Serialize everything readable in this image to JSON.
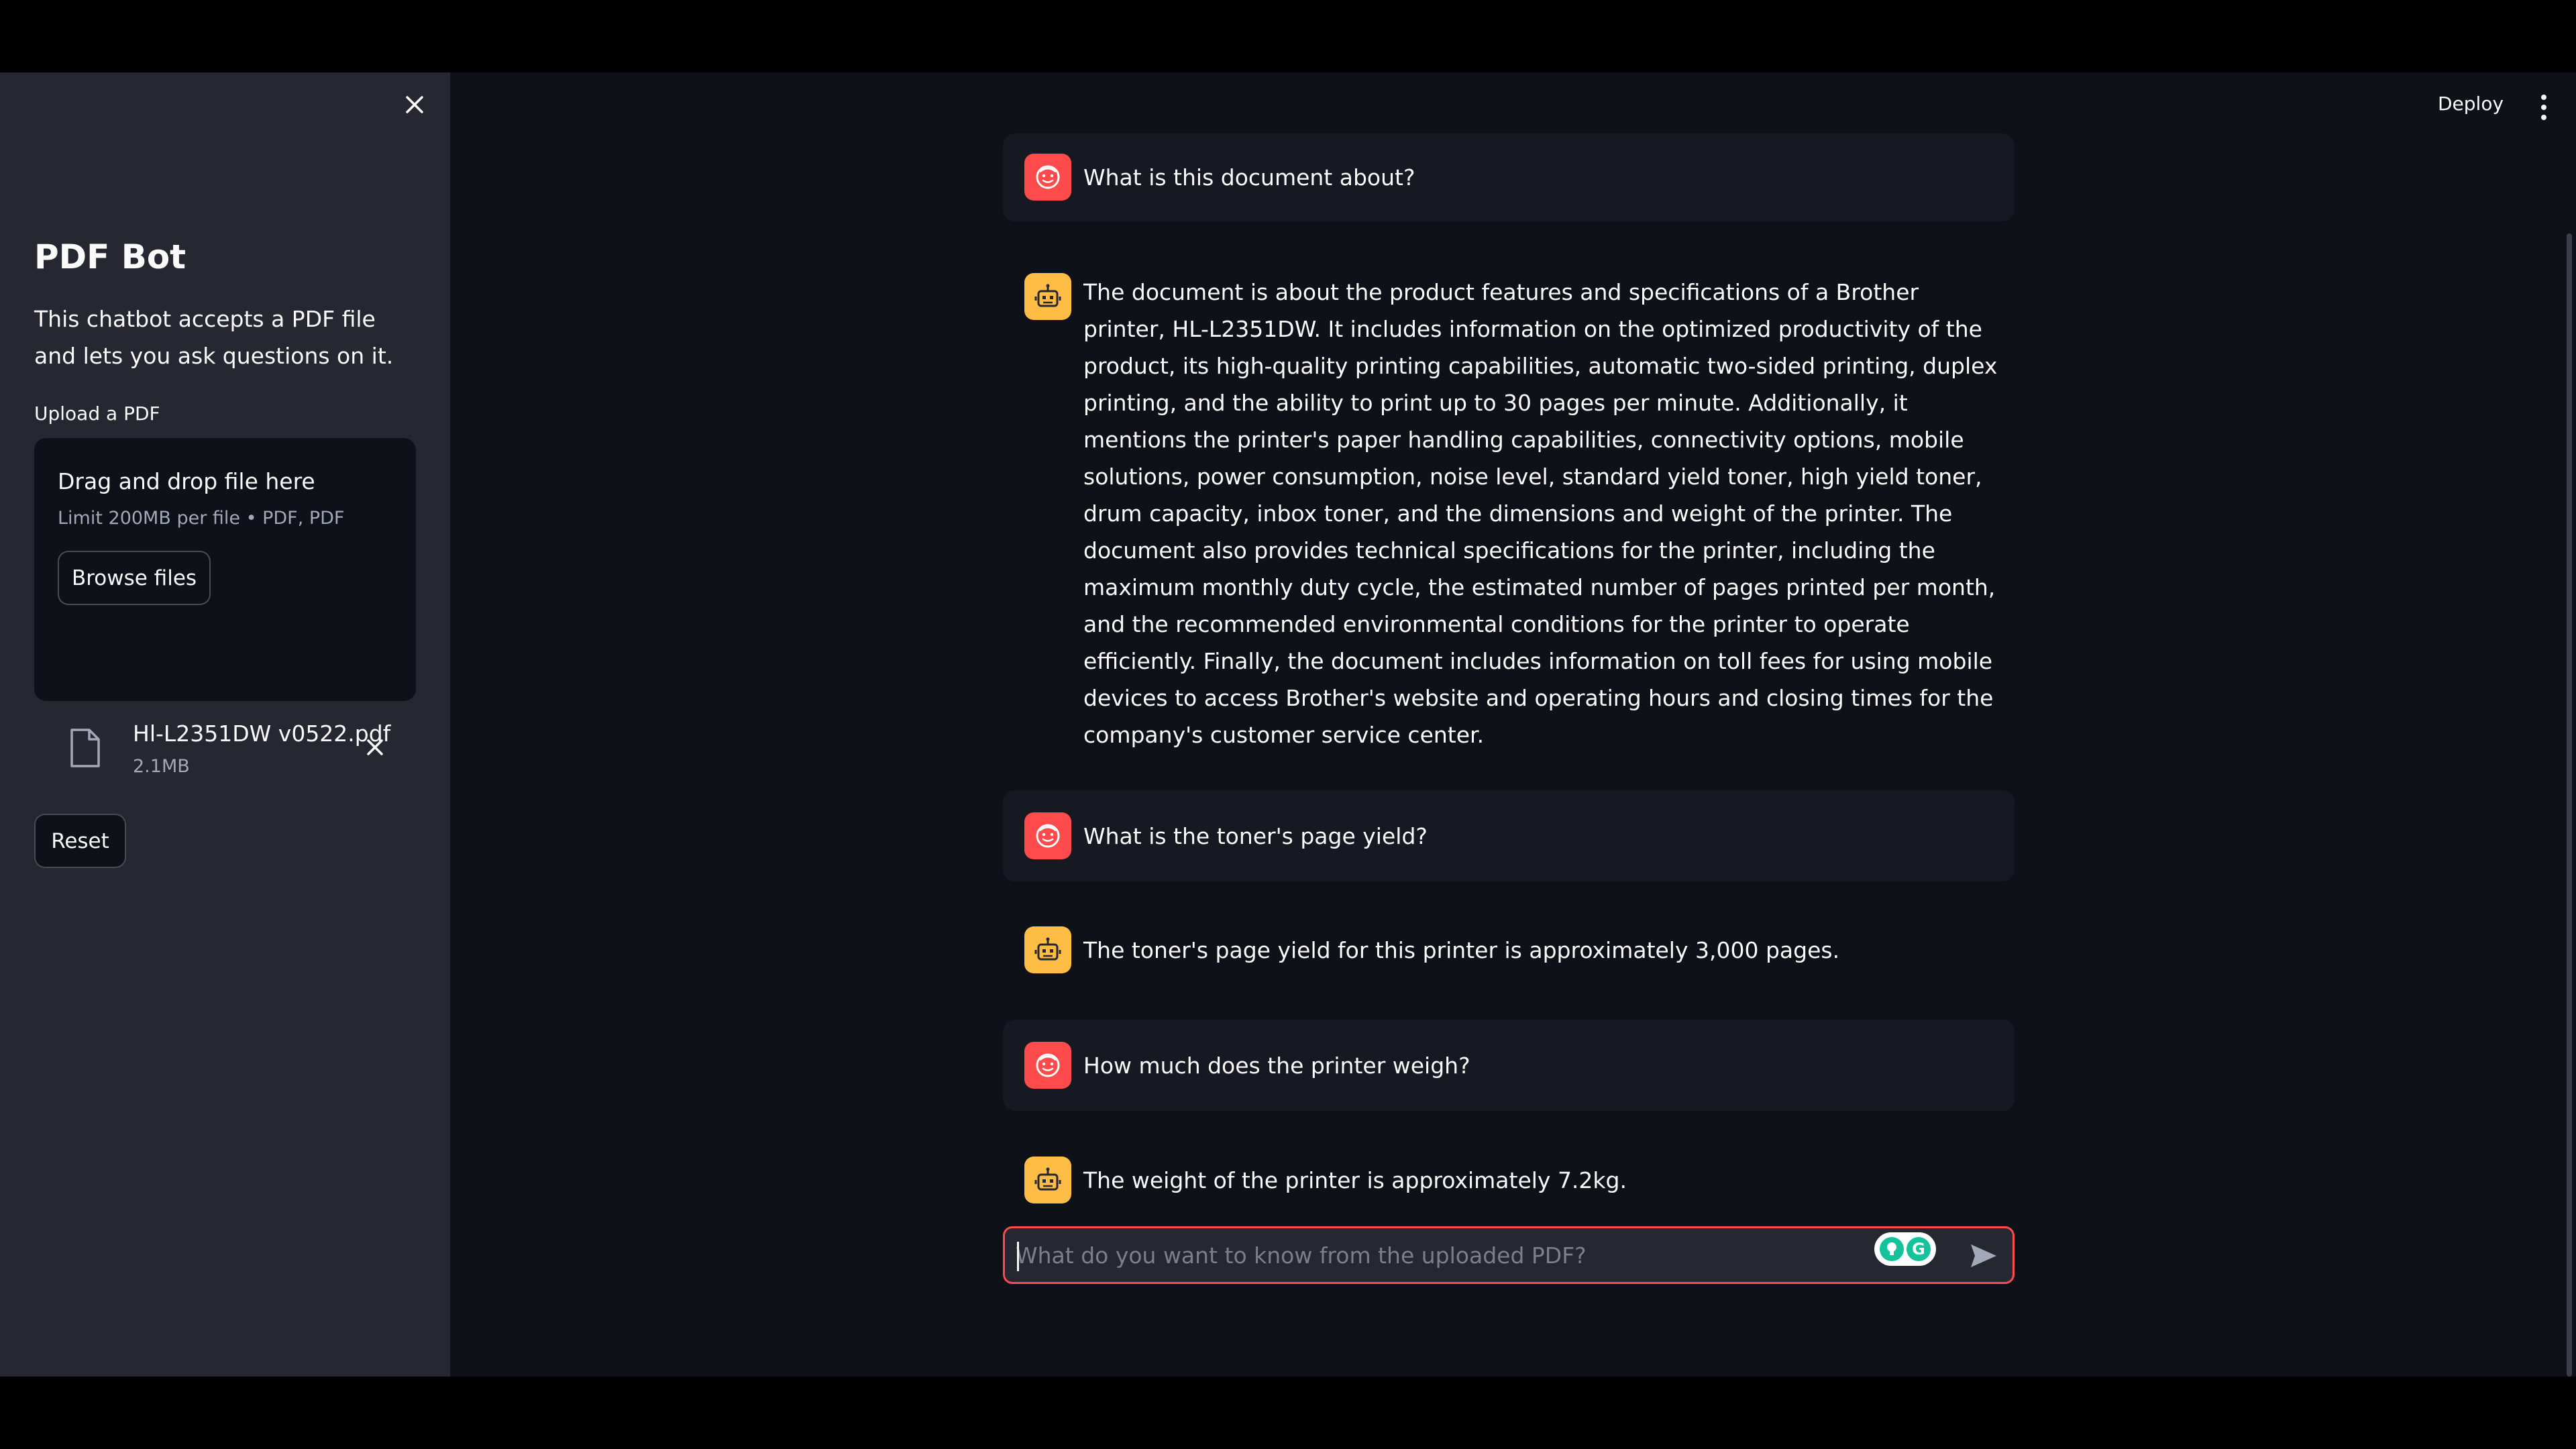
{
  "sidebar": {
    "title": "PDF Bot",
    "description": "This chatbot accepts a PDF file and lets you ask questions on it.",
    "upload_label": "Upload a PDF",
    "dropzone": {
      "title": "Drag and drop file here",
      "limit": "Limit 200MB per file • PDF, PDF",
      "browse_label": "Browse files"
    },
    "uploaded_file": {
      "name": "Hl-L2351DW v0522.pdf",
      "size": "2.1MB"
    },
    "reset_label": "Reset"
  },
  "header": {
    "deploy_label": "Deploy"
  },
  "chat": {
    "messages": [
      {
        "role": "user",
        "text": "What is this document about?"
      },
      {
        "role": "assistant",
        "text": "The document is about the product features and specifications of a Brother printer, HL-L2351DW. It includes information on the optimized productivity of the product, its high-quality printing capabilities, automatic two-sided printing, duplex printing, and the ability to print up to 30 pages per minute. Additionally, it mentions the printer's paper handling capabilities, connectivity options, mobile solutions, power consumption, noise level, standard yield toner, high yield toner, drum capacity, inbox toner, and the dimensions and weight of the printer. The document also provides technical specifications for the printer, including the maximum monthly duty cycle, the estimated number of pages printed per month, and the recommended environmental conditions for the printer to operate efficiently. Finally, the document includes information on toll fees for using mobile devices to access Brother's website and operating hours and closing times for the company's customer service center."
      },
      {
        "role": "user",
        "text": "What is the toner's page yield?"
      },
      {
        "role": "assistant",
        "text": "The toner's page yield for this printer is approximately 3,000 pages."
      },
      {
        "role": "user",
        "text": "How much does the printer weigh?"
      },
      {
        "role": "assistant",
        "text": "The weight of the printer is approximately 7.2kg."
      }
    ],
    "input": {
      "placeholder": "What do you want to know from the uploaded PDF?",
      "value": ""
    }
  },
  "icons": {
    "user_avatar": "user-face-icon",
    "assistant_avatar": "robot-icon",
    "send": "send-arrow-icon",
    "file": "file-icon",
    "close": "close-icon",
    "menu": "more-vertical-icon"
  },
  "colors": {
    "background": "#0e1117",
    "sidebar": "#262730",
    "user_avatar": "#ff4b4b",
    "assistant_avatar": "#ffbd45",
    "input_focus": "#ff4b4b"
  }
}
